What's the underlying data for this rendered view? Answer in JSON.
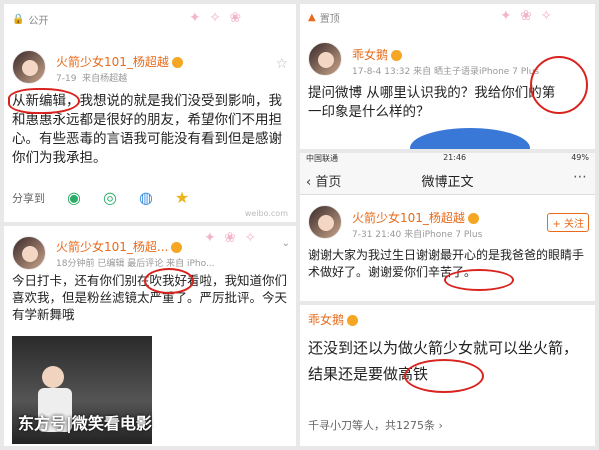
{
  "panel1": {
    "visibility": "公开",
    "name": "火箭少女101_杨超越",
    "time": "7-19",
    "source": "来自杨超越",
    "content": "从新编辑，我想说的就是我们没受到影响，我和惠惠永远都是很好的朋友，希望你们不用担心。有些恶毒的言语我可能没有看到但是感谢你们为我承担。",
    "share_label": "分享到",
    "watermark": "weibo.com"
  },
  "panel2": {
    "pinned": "置顶",
    "name": "乖女鹅",
    "time": "17-8-4 13:32",
    "source": "来自 晒主子语录iPhone 7 Plus",
    "content": "提问微博  从哪里认识我的？我给你们的第一印象是什么样的？"
  },
  "panel3": {
    "name": "火箭少女101_杨超...",
    "time": "18分钟前",
    "source": "来自 iPho...",
    "edit_note": "已编辑",
    "top_note": "最后评论",
    "content": "今日打卡，还有你们别在吹我好看啦，我知道你们喜欢我，但是粉丝滤镜太严重了。严厉批评。今天有学新舞哦"
  },
  "panel4": {
    "status_left": "中国联通",
    "status_time": "21:46",
    "status_battery": "49%",
    "nav_back": "首页",
    "nav_title": "微博正文",
    "name": "火箭少女101_杨超越",
    "time": "7-31 21:40",
    "source": "来自iPhone 7 Plus",
    "follow_label": "+ 关注",
    "content": "谢谢大家为我过生日谢谢最开心的是我爸爸的眼睛手术做好了。谢谢爱你们辛苦了。"
  },
  "panel5": {
    "name": "乖女鹅",
    "content": "还没到还以为做火箭少女就可以坐火箭，结果还是要做高铁",
    "likers": "千寻小刀等人",
    "count": "共1275条",
    "watermark": "东方号|微笑看电影"
  },
  "colors": {
    "accent": "#e86a1a",
    "annotation": "#d9231e"
  }
}
